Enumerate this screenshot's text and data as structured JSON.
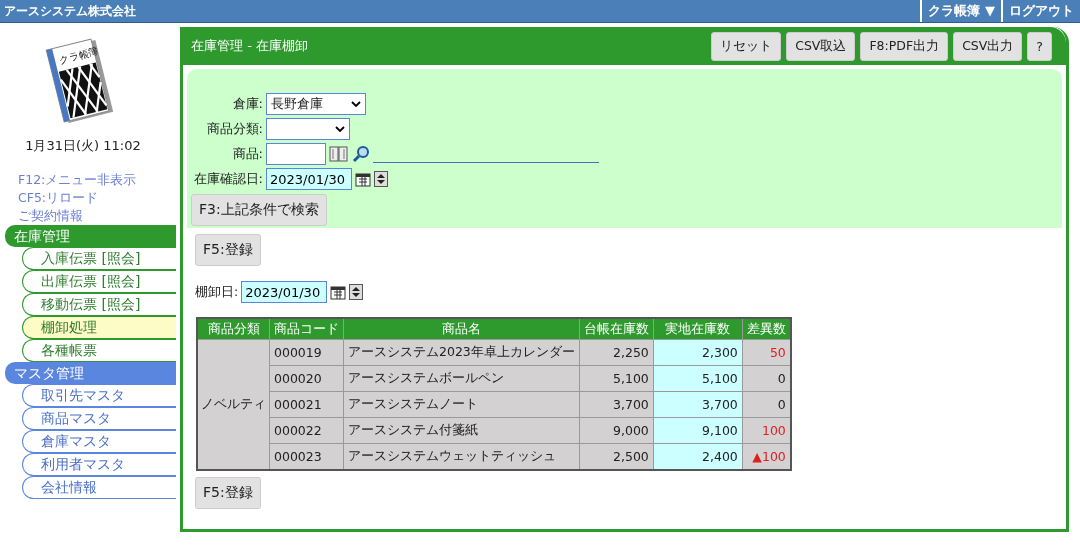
{
  "top_bar": {
    "company": "アースシステム株式会社",
    "app_menu": "クラ帳簿 ▼",
    "logout": "ログアウト"
  },
  "sidebar": {
    "logo_text": "クラ帳簿",
    "datetime": "1月31日(火) 11:02",
    "links": [
      "F12:メニュー非表示",
      "CF5:リロード",
      "ご契約情報"
    ],
    "groups": [
      {
        "label": "在庫管理",
        "color": "#2e9a2e",
        "items": [
          {
            "label": "入庫伝票 [照会]",
            "selected": false
          },
          {
            "label": "出庫伝票 [照会]",
            "selected": false
          },
          {
            "label": "移動伝票 [照会]",
            "selected": false
          },
          {
            "label": "棚卸処理",
            "selected": true
          },
          {
            "label": "各種帳票",
            "selected": false
          }
        ]
      },
      {
        "label": "マスタ管理",
        "color": "#5b86e0",
        "items": [
          {
            "label": "取引先マスタ",
            "selected": false
          },
          {
            "label": "商品マスタ",
            "selected": false
          },
          {
            "label": "倉庫マスタ",
            "selected": false
          },
          {
            "label": "利用者マスタ",
            "selected": false
          },
          {
            "label": "会社情報",
            "selected": false
          }
        ]
      }
    ]
  },
  "panel": {
    "title": "在庫管理 - 在庫棚卸",
    "buttons": [
      "リセット",
      "CSV取込",
      "F8:PDF出力",
      "CSV出力",
      "?"
    ]
  },
  "search": {
    "warehouse": {
      "label": "倉庫:",
      "value": "長野倉庫"
    },
    "category": {
      "label": "商品分類:"
    },
    "product": {
      "label": "商品:"
    },
    "check_date": {
      "label": "在庫確認日:",
      "value": "2023/01/30"
    },
    "search_button": "F3:上記条件で検索"
  },
  "register_button_top": "F5:登録",
  "stocktake_date": {
    "label": "棚卸日:",
    "value": "2023/01/30"
  },
  "table": {
    "columns": [
      "商品分類",
      "商品コード",
      "商品名",
      "台帳在庫数",
      "実地在庫数",
      "差異数"
    ],
    "groups": [
      {
        "category": "ノベルティ",
        "rows": [
          {
            "code": "000019",
            "name": "アースシステム2023年卓上カレンダー",
            "book": "2,250",
            "actual": "2,300",
            "diff": "50",
            "flagged": true
          },
          {
            "code": "000020",
            "name": "アースシステムボールペン",
            "book": "5,100",
            "actual": "5,100",
            "diff": "0",
            "flagged": false
          },
          {
            "code": "000021",
            "name": "アースシステムノート",
            "book": "3,700",
            "actual": "3,700",
            "diff": "0",
            "flagged": false
          },
          {
            "code": "000022",
            "name": "アースシステム付箋紙",
            "book": "9,000",
            "actual": "9,100",
            "diff": "100",
            "flagged": true
          },
          {
            "code": "000023",
            "name": "アースシステムウェットティッシュ",
            "book": "2,500",
            "actual": "2,400",
            "diff": "▲100",
            "flagged": true
          }
        ]
      }
    ]
  },
  "register_button_bottom": "F5:登録"
}
